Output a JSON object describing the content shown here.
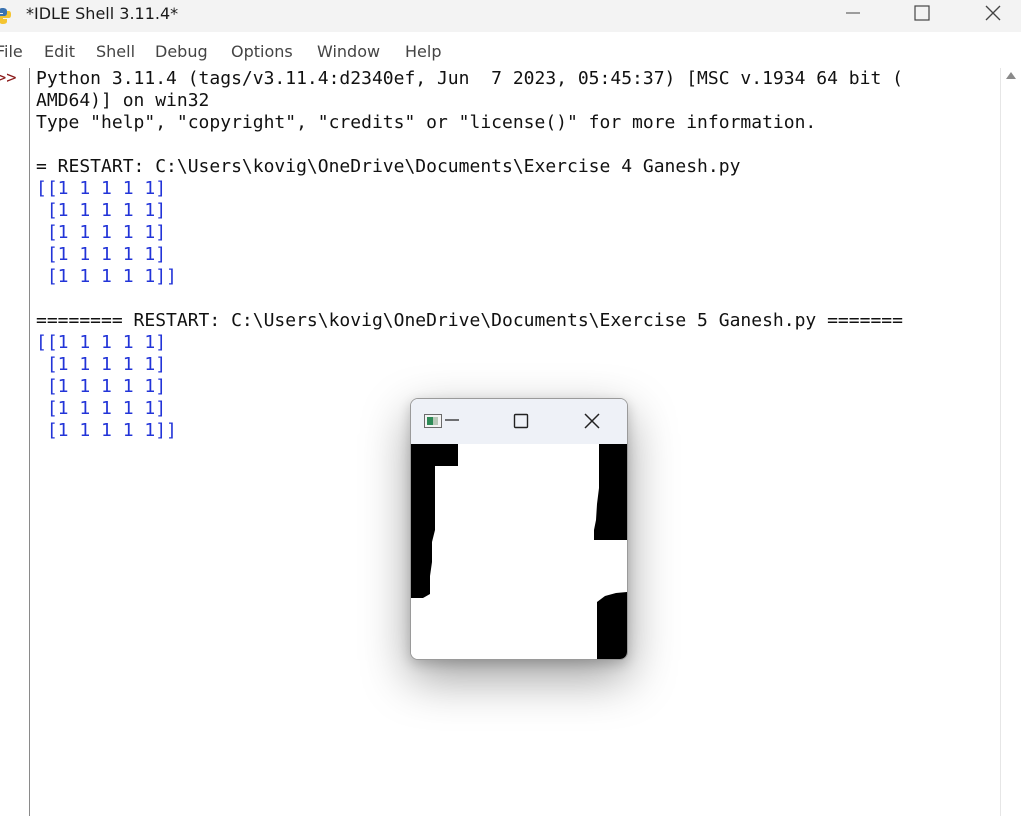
{
  "window": {
    "title": "*IDLE Shell 3.11.4*",
    "app_icon": "python-icon",
    "controls": [
      "minimize-icon",
      "maximize-icon",
      "close-icon"
    ]
  },
  "menu": {
    "file": "File",
    "edit": "Edit",
    "shell": "Shell",
    "debug": "Debug",
    "options": "Options",
    "window": "Window",
    "help": "Help"
  },
  "shell": {
    "prompt": ">>",
    "lines": [
      "Python 3.11.4 (tags/v3.11.4:d2340ef, Jun  7 2023, 05:45:37) [MSC v.1934 64 bit (",
      "AMD64)] on win32",
      "Type \"help\", \"copyright\", \"credits\" or \"license()\" for more information.",
      "",
      "= RESTART: C:\\Users\\kovig\\OneDrive\\Documents\\Exercise 4 Ganesh.py",
      "[[1 1 1 1 1]",
      " [1 1 1 1 1]",
      " [1 1 1 1 1]",
      " [1 1 1 1 1]",
      " [1 1 1 1 1]]",
      "",
      "======== RESTART: C:\\Users\\kovig\\OneDrive\\Documents\\Exercise 5 Ganesh.py =======",
      "[[1 1 1 1 1]",
      " [1 1 1 1 1]",
      " [1 1 1 1 1]",
      " [1 1 1 1 1]",
      " [1 1 1 1 1]]"
    ],
    "output_color": "#2234d8",
    "text_color": "#111111",
    "prompt_color": "#8b1a1a"
  },
  "popup": {
    "app_icon": "image-window-icon",
    "controls": [
      "minimize-icon",
      "maximize-icon",
      "close-icon"
    ],
    "content": "binary-image"
  }
}
